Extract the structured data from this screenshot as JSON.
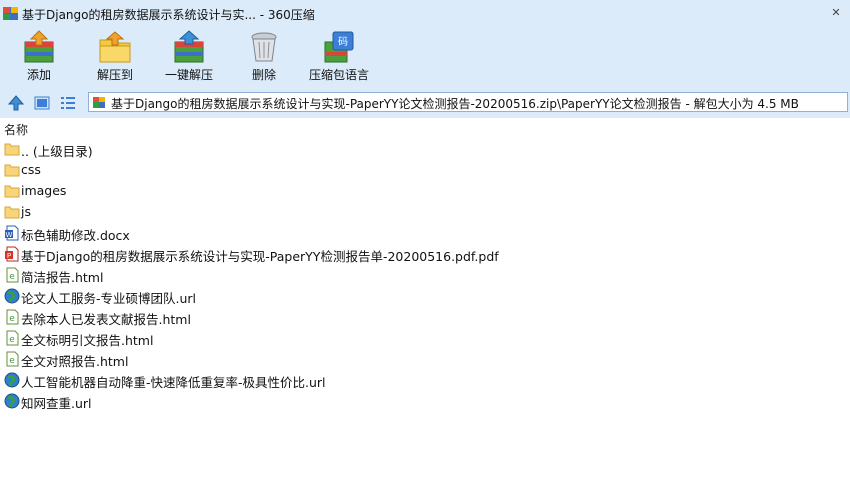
{
  "window": {
    "title": "基于Django的租房数据展示系统设计与实... - 360压缩",
    "close_glyph": "✕"
  },
  "toolbar": {
    "buttons": [
      {
        "label": "添加",
        "icon": "add-archive-icon"
      },
      {
        "label": "解压到",
        "icon": "extract-to-icon"
      },
      {
        "label": "一键解压",
        "icon": "one-click-extract-icon"
      },
      {
        "label": "删除",
        "icon": "trash-icon"
      },
      {
        "label": "压缩包语言",
        "icon": "archive-language-icon"
      }
    ]
  },
  "address": {
    "path": "基于Django的租房数据展示系统设计与实现-PaperYY论文检测报告-20200516.zip\\PaperYY论文检测报告 - 解包大小为 4.5 MB"
  },
  "list": {
    "column_name": "名称",
    "items": [
      {
        "name": ".. (上级目录)",
        "icon": "folder-icon"
      },
      {
        "name": "css",
        "icon": "folder-icon"
      },
      {
        "name": "images",
        "icon": "folder-icon"
      },
      {
        "name": "js",
        "icon": "folder-icon"
      },
      {
        "name": "标色辅助修改.docx",
        "icon": "word-doc-icon"
      },
      {
        "name": "基于Django的租房数据展示系统设计与实现-PaperYY检测报告单-20200516.pdf.pdf",
        "icon": "pdf-icon"
      },
      {
        "name": "简洁报告.html",
        "icon": "html-file-icon"
      },
      {
        "name": "论文人工服务-专业硕博团队.url",
        "icon": "globe-url-icon"
      },
      {
        "name": "去除本人已发表文献报告.html",
        "icon": "html-file-icon"
      },
      {
        "name": "全文标明引文报告.html",
        "icon": "html-file-icon"
      },
      {
        "name": "全文对照报告.html",
        "icon": "html-file-icon"
      },
      {
        "name": "人工智能机器自动降重-快速降低重复率-极具性价比.url",
        "icon": "globe-url-icon"
      },
      {
        "name": "知网查重.url",
        "icon": "globe-url-icon"
      }
    ]
  }
}
